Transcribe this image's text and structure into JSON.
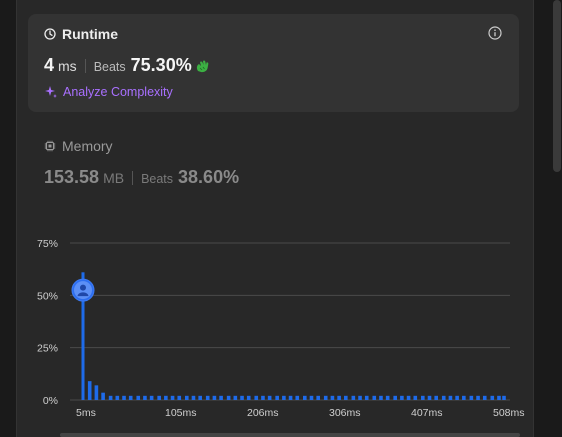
{
  "runtime": {
    "title": "Runtime",
    "value": "4",
    "unit": "ms",
    "beats_label": "Beats",
    "beats_pct": "75.30%",
    "analyze_label": "Analyze Complexity"
  },
  "memory": {
    "title": "Memory",
    "value": "153.58",
    "unit": "MB",
    "beats_label": "Beats",
    "beats_pct": "38.60%"
  },
  "colors": {
    "accent_blue": "#1e6bea",
    "analyze_purple": "#a970ff",
    "clap_green": "#3cb043"
  },
  "icons": [
    "clock-icon",
    "info-icon",
    "clap-icon",
    "sparkle-icon",
    "chip-icon",
    "avatar-icon"
  ],
  "chart_data": {
    "type": "bar",
    "ylim": [
      0,
      75
    ],
    "yticks": [
      "0%",
      "25%",
      "50%",
      "75%"
    ],
    "xtick_labels": [
      "5ms",
      "105ms",
      "206ms",
      "306ms",
      "407ms",
      "508ms"
    ],
    "x": [
      5,
      13,
      21,
      29,
      38,
      46,
      54,
      62,
      71,
      79,
      87,
      96,
      104,
      112,
      120,
      129,
      137,
      145,
      154,
      162,
      170,
      179,
      187,
      195,
      203,
      212,
      220,
      228,
      237,
      245,
      253,
      261,
      270,
      278,
      286,
      295,
      303,
      311,
      319,
      328,
      336,
      344,
      353,
      361,
      369,
      378,
      386,
      394,
      402,
      411,
      419,
      427,
      436,
      444,
      452,
      460,
      469,
      477,
      485,
      494,
      502,
      508
    ],
    "values": [
      61,
      9,
      7,
      3.5,
      2,
      2,
      2,
      2,
      2,
      2,
      2,
      2,
      2,
      2,
      2,
      2,
      2,
      2,
      2,
      2,
      2,
      2,
      2,
      2,
      2,
      2,
      2,
      2,
      2,
      2,
      2,
      2,
      2,
      2,
      2,
      2,
      2,
      2,
      2,
      2,
      2,
      2,
      2,
      2,
      2,
      2,
      2,
      2,
      2,
      2,
      2,
      2,
      2,
      2,
      2,
      2,
      2,
      2,
      2,
      2,
      2,
      2
    ],
    "highlight": {
      "x": 5,
      "y": 52.5
    }
  }
}
